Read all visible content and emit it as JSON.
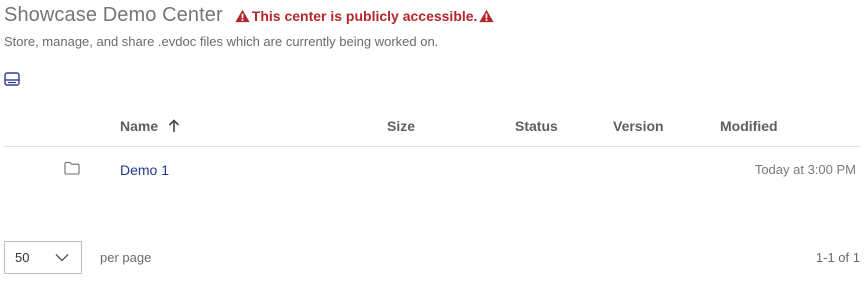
{
  "header": {
    "title": "Showcase Demo Center",
    "warning": "This center is publicly accessible.",
    "subtitle": "Store, manage, and share .evdoc files which are currently being worked on."
  },
  "toolbar": {
    "view_toggle_icon": "card-view-icon"
  },
  "table": {
    "columns": {
      "name": "Name",
      "size": "Size",
      "status": "Status",
      "version": "Version",
      "modified": "Modified"
    },
    "sort": {
      "column": "Name",
      "direction": "ascending",
      "icon": "arrow-up-icon"
    },
    "rows": [
      {
        "icon": "folder-icon",
        "name": "Demo 1",
        "size": "",
        "status": "",
        "version": "",
        "modified": "Today at 3:00 PM"
      }
    ]
  },
  "pagination": {
    "per_page_value": "50",
    "per_page_label": "per page",
    "range": "1-1 of 1"
  },
  "colors": {
    "warning": "#b3262b",
    "link": "#1f3a8a",
    "accent_icon": "#2c3e8f"
  }
}
